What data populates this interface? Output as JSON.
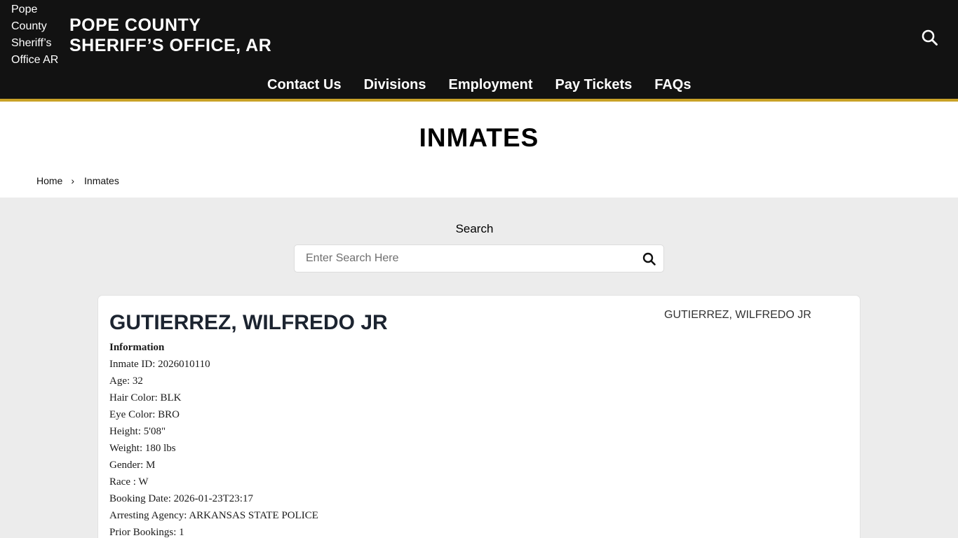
{
  "header": {
    "logo_alt": "Pope County Sheriff’s Office AR",
    "title_line1": "POPE COUNTY",
    "title_line2": "SHERIFF’S OFFICE, AR",
    "search_icon": "search-icon"
  },
  "nav": {
    "items": [
      {
        "label": "Contact Us"
      },
      {
        "label": "Divisions"
      },
      {
        "label": "Employment"
      },
      {
        "label": "Pay Tickets"
      },
      {
        "label": "FAQs"
      }
    ]
  },
  "page": {
    "title": "INMATES"
  },
  "breadcrumb": {
    "home": "Home",
    "separator": "›",
    "current": "Inmates"
  },
  "search": {
    "label": "Search",
    "placeholder": "Enter Search Here",
    "icon": "search-icon"
  },
  "inmate": {
    "name": "GUTIERREZ, WILFREDO JR",
    "photo_alt": "GUTIERREZ, WILFREDO JR",
    "info_heading": "Information",
    "details": [
      "Inmate ID: 2026010110",
      "Age: 32",
      "Hair Color: BLK",
      "Eye Color: BRO",
      "Height: 5'08\"",
      "Weight: 180 lbs",
      "Gender: M",
      "Race : W",
      "Booking Date: 2026-01-23T23:17",
      "Arresting Agency: ARKANSAS STATE POLICE",
      "Prior Bookings: 1"
    ]
  },
  "colors": {
    "header_bg": "#121212",
    "accent": "#c9a227",
    "content_bg": "#ececec",
    "name_color": "#1c2430"
  }
}
